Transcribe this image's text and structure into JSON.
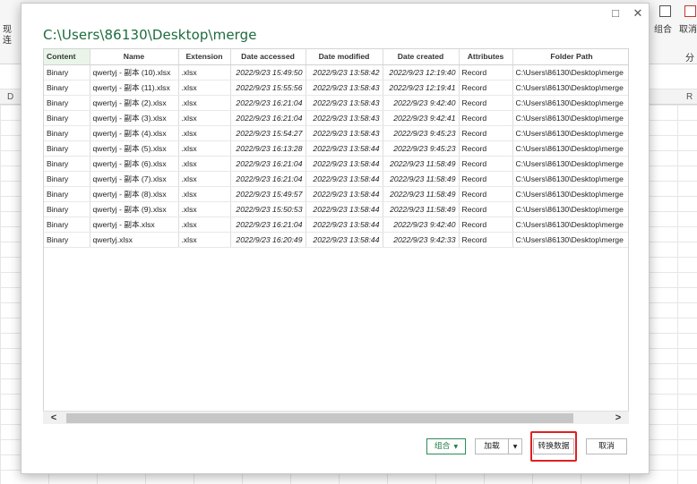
{
  "excel": {
    "ribbon_fragments": [
      "现",
      "连",
      "组合",
      "取消",
      "分"
    ],
    "col_left": "D",
    "col_right": "R"
  },
  "dialog": {
    "title": "C:\\Users\\86130\\Desktop\\merge",
    "window_icons": {
      "maximize": "□",
      "close": "✕"
    },
    "columns": [
      "Content",
      "Name",
      "Extension",
      "Date accessed",
      "Date modified",
      "Date created",
      "Attributes",
      "Folder Path"
    ],
    "rows": [
      [
        "Binary",
        "qwertyj - 副本 (10).xlsx",
        ".xlsx",
        "2022/9/23 15:49:50",
        "2022/9/23 13:58:42",
        "2022/9/23 12:19:40",
        "Record",
        "C:\\Users\\86130\\Desktop\\merge"
      ],
      [
        "Binary",
        "qwertyj - 副本 (11).xlsx",
        ".xlsx",
        "2022/9/23 15:55:56",
        "2022/9/23 13:58:43",
        "2022/9/23 12:19:41",
        "Record",
        "C:\\Users\\86130\\Desktop\\merge"
      ],
      [
        "Binary",
        "qwertyj - 副本 (2).xlsx",
        ".xlsx",
        "2022/9/23 16:21:04",
        "2022/9/23 13:58:43",
        "2022/9/23 9:42:40",
        "Record",
        "C:\\Users\\86130\\Desktop\\merge"
      ],
      [
        "Binary",
        "qwertyj - 副本 (3).xlsx",
        ".xlsx",
        "2022/9/23 16:21:04",
        "2022/9/23 13:58:43",
        "2022/9/23 9:42:41",
        "Record",
        "C:\\Users\\86130\\Desktop\\merge"
      ],
      [
        "Binary",
        "qwertyj - 副本 (4).xlsx",
        ".xlsx",
        "2022/9/23 15:54:27",
        "2022/9/23 13:58:43",
        "2022/9/23 9:45:23",
        "Record",
        "C:\\Users\\86130\\Desktop\\merge"
      ],
      [
        "Binary",
        "qwertyj - 副本 (5).xlsx",
        ".xlsx",
        "2022/9/23 16:13:28",
        "2022/9/23 13:58:44",
        "2022/9/23 9:45:23",
        "Record",
        "C:\\Users\\86130\\Desktop\\merge"
      ],
      [
        "Binary",
        "qwertyj - 副本 (6).xlsx",
        ".xlsx",
        "2022/9/23 16:21:04",
        "2022/9/23 13:58:44",
        "2022/9/23 11:58:49",
        "Record",
        "C:\\Users\\86130\\Desktop\\merge"
      ],
      [
        "Binary",
        "qwertyj - 副本 (7).xlsx",
        ".xlsx",
        "2022/9/23 16:21:04",
        "2022/9/23 13:58:44",
        "2022/9/23 11:58:49",
        "Record",
        "C:\\Users\\86130\\Desktop\\merge"
      ],
      [
        "Binary",
        "qwertyj - 副本 (8).xlsx",
        ".xlsx",
        "2022/9/23 15:49:57",
        "2022/9/23 13:58:44",
        "2022/9/23 11:58:49",
        "Record",
        "C:\\Users\\86130\\Desktop\\merge"
      ],
      [
        "Binary",
        "qwertyj - 副本 (9).xlsx",
        ".xlsx",
        "2022/9/23 15:50:53",
        "2022/9/23 13:58:44",
        "2022/9/23 11:58:49",
        "Record",
        "C:\\Users\\86130\\Desktop\\merge"
      ],
      [
        "Binary",
        "qwertyj - 副本.xlsx",
        ".xlsx",
        "2022/9/23 16:21:04",
        "2022/9/23 13:58:44",
        "2022/9/23 9:42:40",
        "Record",
        "C:\\Users\\86130\\Desktop\\merge"
      ],
      [
        "Binary",
        "qwertyj.xlsx",
        ".xlsx",
        "2022/9/23 16:20:49",
        "2022/9/23 13:58:44",
        "2022/9/23 9:42:33",
        "Record",
        "C:\\Users\\86130\\Desktop\\merge"
      ]
    ],
    "buttons": {
      "combine": "组合",
      "load": "加载",
      "transform": "转换数据",
      "cancel": "取消"
    },
    "scroll_arrows": {
      "left": "<",
      "right": ">"
    },
    "colors": {
      "title": "#1e6b3d",
      "highlight": "#e02020",
      "combine_border": "#2e8b57"
    }
  }
}
